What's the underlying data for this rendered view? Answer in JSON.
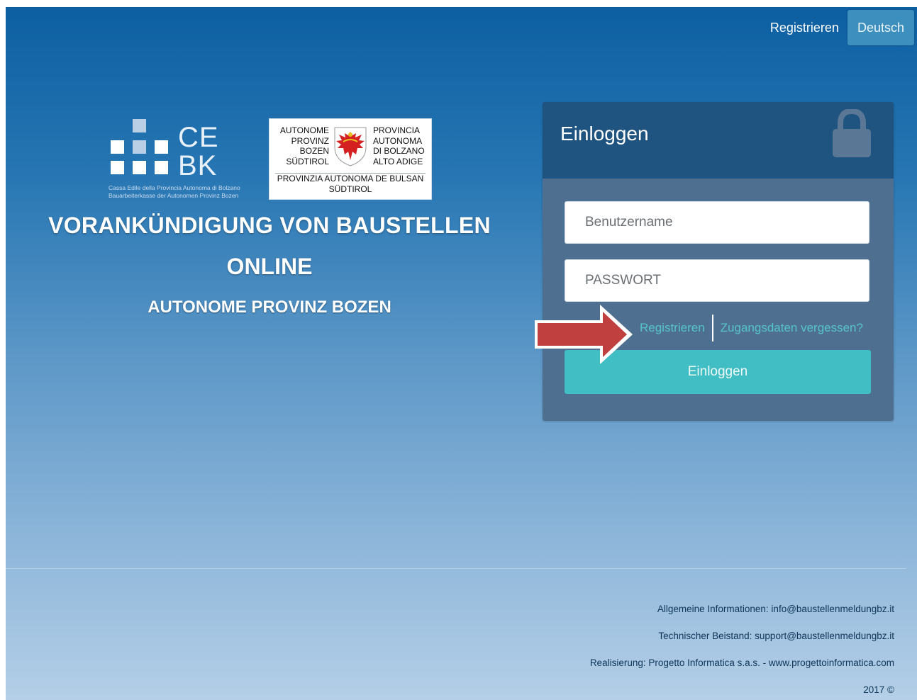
{
  "nav": {
    "register_label": "Registrieren",
    "language_label": "Deutsch"
  },
  "logos": {
    "cebk_letters_top": "CE",
    "cebk_letters_bottom": "BK",
    "cebk_caption_line1": "Cassa Edile della Provincia Autonoma di Bolzano",
    "cebk_caption_line2": "Bauarbeiterkasse der Autonomen Provinz Bozen",
    "province_de": [
      "AUTONOME",
      "PROVINZ",
      "BOZEN",
      "SÜDTIROL"
    ],
    "province_it": [
      "PROVINCIA",
      "AUTONOMA",
      "DI BOLZANO",
      "ALTO ADIGE"
    ],
    "province_lad_line1": "PROVINZIA AUTONOMA DE BULSAN",
    "province_lad_line2": "SÜDTIROL"
  },
  "headings": {
    "main": "VORANKÜNDIGUNG VON BAUSTELLEN",
    "online": "ONLINE",
    "sub": "AUTONOME PROVINZ BOZEN"
  },
  "login": {
    "title": "Einloggen",
    "username_placeholder": "Benutzername",
    "password_placeholder": "PASSWORT",
    "register_link": "Registrieren",
    "forgot_link": "Zugangsdaten vergessen?",
    "submit_label": "Einloggen"
  },
  "footer": {
    "info": "Allgemeine Informationen: info@baustellenmeldungbz.it",
    "support": "Technischer Beistand: support@baustellenmeldungbz.it",
    "credit": "Realisierung: Progetto Informatica s.a.s. - www.progettoinformatica.com",
    "copyright": "2017 ©"
  },
  "colors": {
    "accent": "#41bdc4",
    "link": "#55c5c9",
    "panel_head": "#1f5480",
    "panel_body": "#4f6f91",
    "arrow": "#c0403f"
  },
  "icons": {
    "lock": "lock-icon",
    "arrow": "arrow-right-icon",
    "eagle": "eagle-coat-of-arms-icon"
  }
}
